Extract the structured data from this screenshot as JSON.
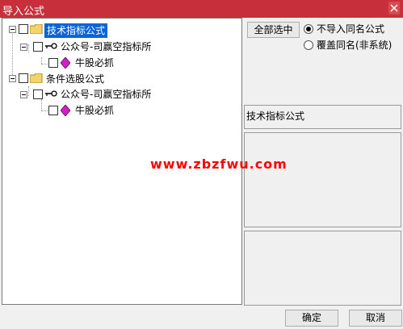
{
  "window": {
    "title": "导入公式"
  },
  "tree": {
    "groups": [
      {
        "label": "技术指标公式",
        "child": "公众号-司赢空指标所",
        "leaf": "牛股必抓"
      },
      {
        "label": "条件选股公式",
        "child": "公众号-司赢空指标所",
        "leaf": "牛股必抓"
      }
    ]
  },
  "options": {
    "select_all_label": "全部选中",
    "radio_no_import": "不导入同名公式",
    "radio_overwrite": "覆盖同名(非系统)"
  },
  "info": {
    "category_label": "技术指标公式"
  },
  "watermark": "www.zbzfwu.com",
  "footer": {
    "ok_label": "确定",
    "cancel_label": "取消"
  },
  "colors": {
    "titlebar": "#c7303b",
    "selection": "#0a64d8",
    "watermark": "#ff0000"
  },
  "icons": [
    "folder-icon",
    "key-icon",
    "diamond-icon",
    "close-icon"
  ]
}
